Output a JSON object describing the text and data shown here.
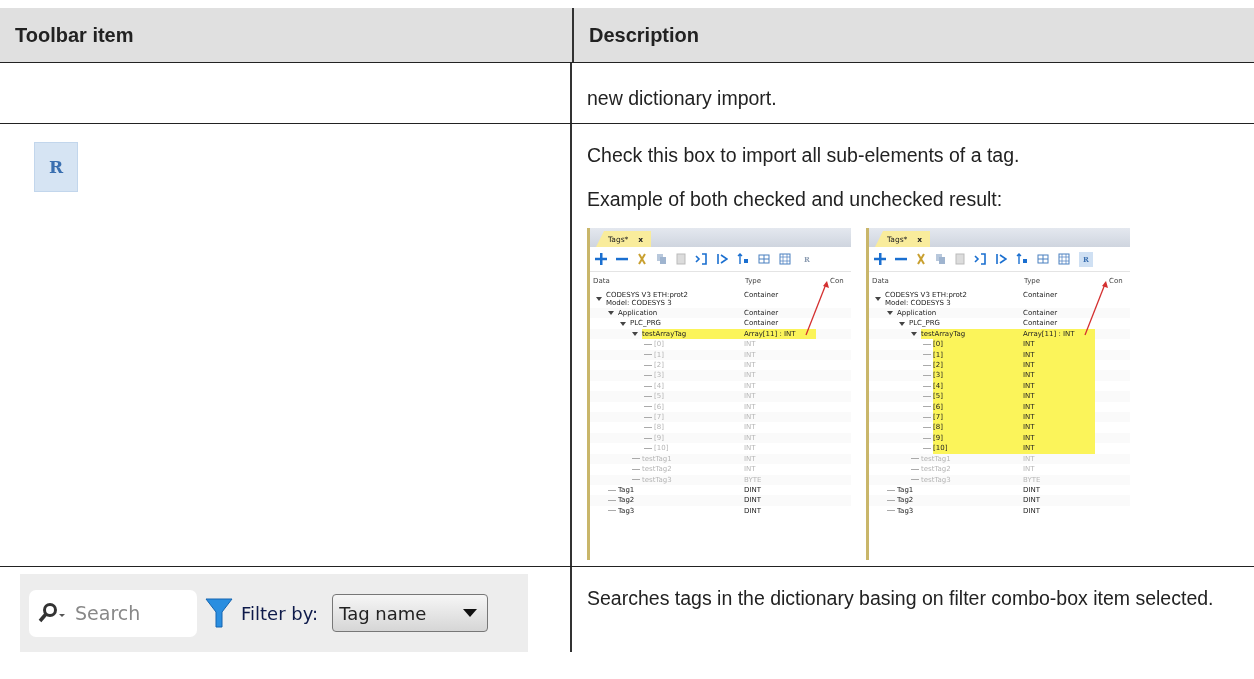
{
  "table": {
    "columns": [
      "Toolbar item",
      "Description"
    ],
    "rows": [
      {
        "kind": "text",
        "description": [
          "new dictionary import."
        ]
      },
      {
        "kind": "screens",
        "item_glyph": "R",
        "description": [
          "Check this box to import all sub-elements of a tag.",
          "Example of both checked and unchecked result:"
        ],
        "shots": [
          {
            "tab": "Tags*",
            "close": "x",
            "r_button": {
              "label": "R",
              "selected": false
            },
            "headers": [
              "Data",
              "Type",
              "Con"
            ],
            "tree": [
              {
                "name": "CODESYS V3 ETH:prot2\nModel: CODESYS 3",
                "type": "Container",
                "expanded": true,
                "highlighted": false,
                "dimmed": false,
                "children": [
                  {
                    "name": "Application",
                    "type": "Container",
                    "expanded": true,
                    "highlighted": false,
                    "dimmed": false,
                    "children": [
                      {
                        "name": "PLC_PRG",
                        "type": "Container",
                        "expanded": true,
                        "highlighted": false,
                        "dimmed": false,
                        "children": [
                          {
                            "name": "testArrayTag",
                            "type": "Array[11] : INT",
                            "expanded": true,
                            "highlighted": true,
                            "dimmed": false,
                            "children": [
                              {
                                "name": "[0]",
                                "type": "INT",
                                "highlighted": false,
                                "dimmed": true
                              },
                              {
                                "name": "[1]",
                                "type": "INT",
                                "highlighted": false,
                                "dimmed": true
                              },
                              {
                                "name": "[2]",
                                "type": "INT",
                                "highlighted": false,
                                "dimmed": true
                              },
                              {
                                "name": "[3]",
                                "type": "INT",
                                "highlighted": false,
                                "dimmed": true
                              },
                              {
                                "name": "[4]",
                                "type": "INT",
                                "highlighted": false,
                                "dimmed": true
                              },
                              {
                                "name": "[5]",
                                "type": "INT",
                                "highlighted": false,
                                "dimmed": true
                              },
                              {
                                "name": "[6]",
                                "type": "INT",
                                "highlighted": false,
                                "dimmed": true
                              },
                              {
                                "name": "[7]",
                                "type": "INT",
                                "highlighted": false,
                                "dimmed": true
                              },
                              {
                                "name": "[8]",
                                "type": "INT",
                                "highlighted": false,
                                "dimmed": true
                              },
                              {
                                "name": "[9]",
                                "type": "INT",
                                "highlighted": false,
                                "dimmed": true
                              },
                              {
                                "name": "[10]",
                                "type": "INT",
                                "highlighted": false,
                                "dimmed": true
                              }
                            ]
                          },
                          {
                            "name": "testTag1",
                            "type": "INT",
                            "highlighted": false,
                            "dimmed": true
                          },
                          {
                            "name": "testTag2",
                            "type": "INT",
                            "highlighted": false,
                            "dimmed": true
                          },
                          {
                            "name": "testTag3",
                            "type": "BYTE",
                            "highlighted": false,
                            "dimmed": true
                          }
                        ]
                      }
                    ]
                  },
                  {
                    "name": "Tag1",
                    "type": "DINT",
                    "highlighted": false,
                    "dimmed": false
                  },
                  {
                    "name": "Tag2",
                    "type": "DINT",
                    "highlighted": false,
                    "dimmed": false
                  },
                  {
                    "name": "Tag3",
                    "type": "DINT",
                    "highlighted": false,
                    "dimmed": false
                  }
                ]
              }
            ]
          },
          {
            "tab": "Tags*",
            "close": "x",
            "r_button": {
              "label": "R",
              "selected": true
            },
            "headers": [
              "Data",
              "Type",
              "Con"
            ],
            "tree": [
              {
                "name": "CODESYS V3 ETH:prot2\nModel: CODESYS 3",
                "type": "Container",
                "expanded": true,
                "highlighted": false,
                "dimmed": false,
                "children": [
                  {
                    "name": "Application",
                    "type": "Container",
                    "expanded": true,
                    "highlighted": false,
                    "dimmed": false,
                    "children": [
                      {
                        "name": "PLC_PRG",
                        "type": "Container",
                        "expanded": true,
                        "highlighted": false,
                        "dimmed": false,
                        "children": [
                          {
                            "name": "testArrayTag",
                            "type": "Array[11] : INT",
                            "expanded": true,
                            "highlighted": true,
                            "dimmed": false,
                            "children": [
                              {
                                "name": "[0]",
                                "type": "INT",
                                "highlighted": true,
                                "dimmed": false
                              },
                              {
                                "name": "[1]",
                                "type": "INT",
                                "highlighted": true,
                                "dimmed": false
                              },
                              {
                                "name": "[2]",
                                "type": "INT",
                                "highlighted": true,
                                "dimmed": false
                              },
                              {
                                "name": "[3]",
                                "type": "INT",
                                "highlighted": true,
                                "dimmed": false
                              },
                              {
                                "name": "[4]",
                                "type": "INT",
                                "highlighted": true,
                                "dimmed": false
                              },
                              {
                                "name": "[5]",
                                "type": "INT",
                                "highlighted": true,
                                "dimmed": false
                              },
                              {
                                "name": "[6]",
                                "type": "INT",
                                "highlighted": true,
                                "dimmed": false
                              },
                              {
                                "name": "[7]",
                                "type": "INT",
                                "highlighted": true,
                                "dimmed": false
                              },
                              {
                                "name": "[8]",
                                "type": "INT",
                                "highlighted": true,
                                "dimmed": false
                              },
                              {
                                "name": "[9]",
                                "type": "INT",
                                "highlighted": true,
                                "dimmed": false
                              },
                              {
                                "name": "[10]",
                                "type": "INT",
                                "highlighted": true,
                                "dimmed": false
                              }
                            ]
                          },
                          {
                            "name": "testTag1",
                            "type": "INT",
                            "highlighted": false,
                            "dimmed": true
                          },
                          {
                            "name": "testTag2",
                            "type": "INT",
                            "highlighted": false,
                            "dimmed": true
                          },
                          {
                            "name": "testTag3",
                            "type": "BYTE",
                            "highlighted": false,
                            "dimmed": true
                          }
                        ]
                      }
                    ]
                  },
                  {
                    "name": "Tag1",
                    "type": "DINT",
                    "highlighted": false,
                    "dimmed": false
                  },
                  {
                    "name": "Tag2",
                    "type": "DINT",
                    "highlighted": false,
                    "dimmed": false
                  },
                  {
                    "name": "Tag3",
                    "type": "DINT",
                    "highlighted": false,
                    "dimmed": false
                  }
                ]
              }
            ]
          }
        ]
      },
      {
        "kind": "search",
        "search_placeholder": "Search",
        "filter_label": "Filter by:",
        "filter_value": "Tag name",
        "description": [
          "Searches tags in the dictionary basing on filter combo-box item selected."
        ]
      }
    ]
  }
}
